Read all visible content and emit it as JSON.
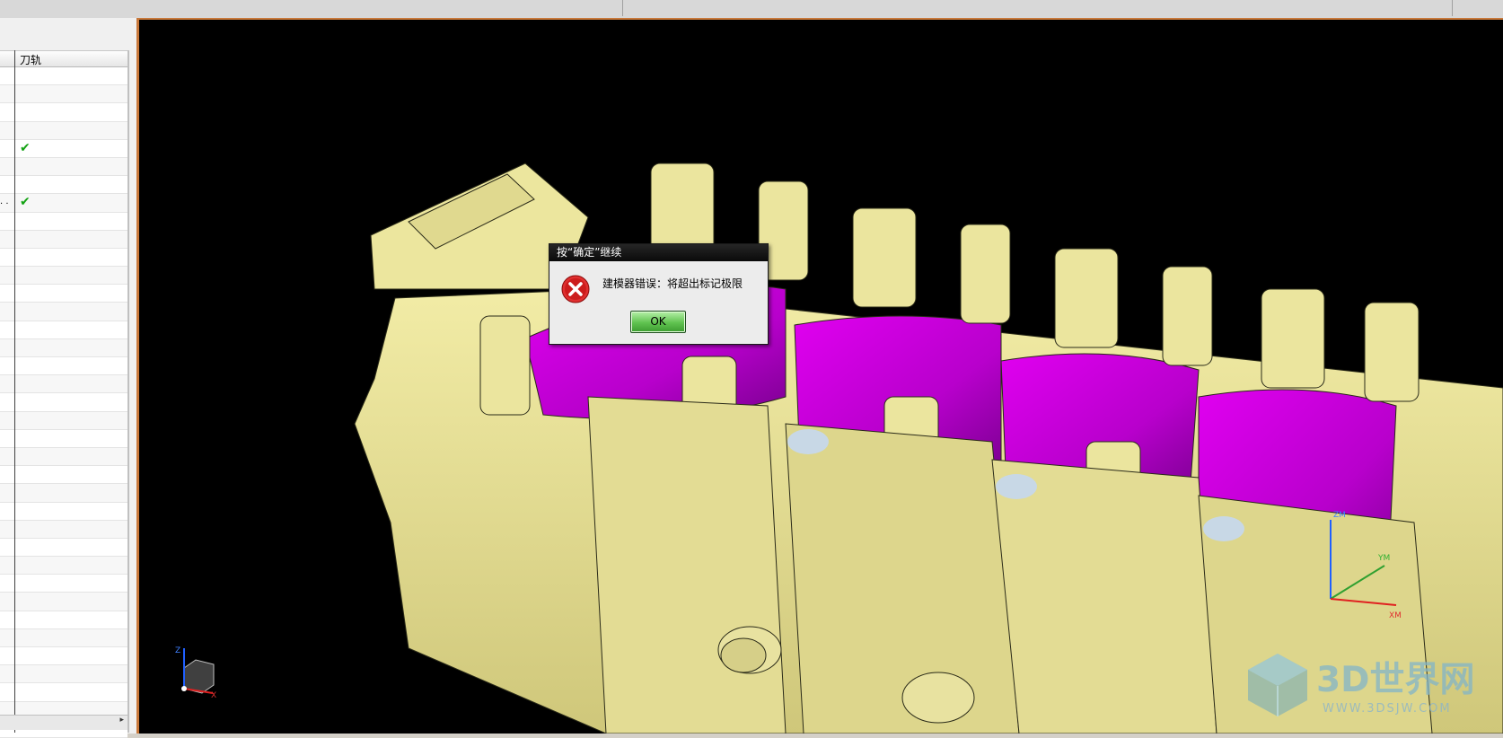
{
  "navigator": {
    "column_header": "刀轨",
    "rows": [
      {
        "check": "",
        "dots": ""
      },
      {
        "check": "",
        "dots": ""
      },
      {
        "check": "",
        "dots": ""
      },
      {
        "check": "",
        "dots": ""
      },
      {
        "check": "✔",
        "dots": ""
      },
      {
        "check": "",
        "dots": ""
      },
      {
        "check": "",
        "dots": ""
      },
      {
        "check": "✔",
        "dots": ". ."
      },
      {
        "check": "",
        "dots": ""
      },
      {
        "check": "",
        "dots": ""
      },
      {
        "check": "",
        "dots": ""
      },
      {
        "check": "",
        "dots": ""
      },
      {
        "check": "",
        "dots": ""
      },
      {
        "check": "",
        "dots": ""
      },
      {
        "check": "",
        "dots": ""
      },
      {
        "check": "",
        "dots": ""
      },
      {
        "check": "",
        "dots": ""
      },
      {
        "check": "",
        "dots": ""
      },
      {
        "check": "",
        "dots": ""
      },
      {
        "check": "",
        "dots": ""
      },
      {
        "check": "",
        "dots": ""
      },
      {
        "check": "",
        "dots": ""
      },
      {
        "check": "",
        "dots": ""
      },
      {
        "check": "",
        "dots": ""
      },
      {
        "check": "",
        "dots": ""
      },
      {
        "check": "",
        "dots": ""
      },
      {
        "check": "",
        "dots": ""
      },
      {
        "check": "",
        "dots": ""
      },
      {
        "check": "",
        "dots": ""
      },
      {
        "check": "",
        "dots": ""
      },
      {
        "check": "",
        "dots": ""
      },
      {
        "check": "",
        "dots": ""
      },
      {
        "check": "",
        "dots": ""
      },
      {
        "check": "",
        "dots": ""
      },
      {
        "check": "",
        "dots": ""
      },
      {
        "check": "",
        "dots": ""
      },
      {
        "check": "",
        "dots": ""
      }
    ],
    "scroll_arrow": "▸"
  },
  "dialog": {
    "title": "按“确定”继续",
    "message": "建模器错误：将超出标记极限",
    "ok_label": "OK"
  },
  "triad_small": {
    "z": "Z",
    "x": "X"
  },
  "wcs": {
    "zm": "ZM",
    "ym": "YM",
    "xm": "XM"
  },
  "watermark": {
    "brand": "3D世界网",
    "url": "WWW.3DSJW.COM"
  },
  "colors": {
    "part_yellow": "#e8e39a",
    "pocket_magenta": "#c400d8",
    "viewport_bg": "#000000",
    "accent_orange": "#c8783a",
    "check_green": "#13a213"
  }
}
